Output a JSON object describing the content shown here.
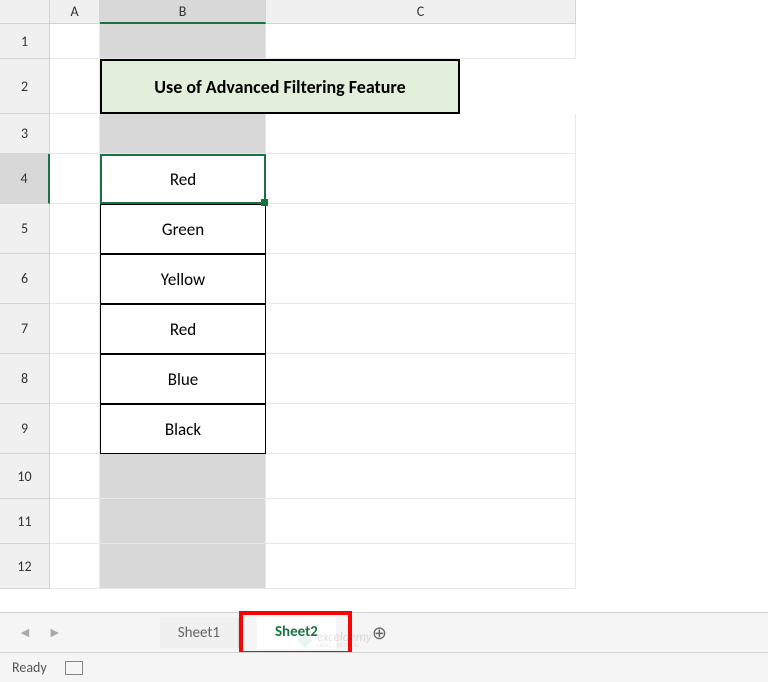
{
  "columns": [
    "A",
    "B",
    "C"
  ],
  "rows": [
    "1",
    "2",
    "3",
    "4",
    "5",
    "6",
    "7",
    "8",
    "9",
    "10",
    "11",
    "12"
  ],
  "title_cell": "Use of Advanced Filtering Feature",
  "data": {
    "b4": "Red",
    "b5": "Green",
    "b6": "Yellow",
    "b7": "Red",
    "b8": "Blue",
    "b9": "Black"
  },
  "sheet_tabs": {
    "tab1": "Sheet1",
    "tab2": "Sheet2"
  },
  "status": {
    "ready": "Ready"
  },
  "watermark": {
    "main": "exceldemy",
    "sub": "EXCEL · DATA · BI"
  },
  "add_sheet_symbol": "⊕"
}
